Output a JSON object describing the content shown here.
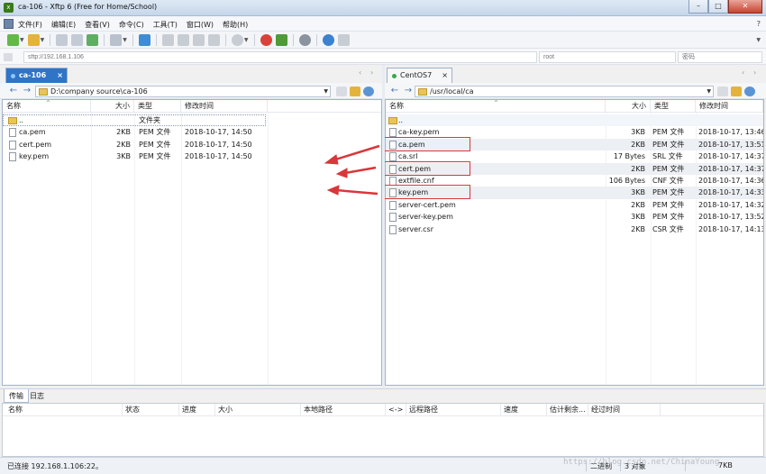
{
  "window": {
    "title": "ca-106 - Xftp 6 (Free for Home/School)",
    "app_icon": "xftp-app-icon",
    "accent_color": "#2f74c7",
    "controls": {
      "minimize": "–",
      "maximize": "□",
      "close": "✕"
    }
  },
  "menubar": {
    "items": [
      "文件(F)",
      "编辑(E)",
      "查看(V)",
      "命令(C)",
      "工具(T)",
      "窗口(W)",
      "帮助(H)"
    ],
    "help_glyph": "?"
  },
  "addressbar": {
    "host_placeholder": "sftp://192.168.1.106",
    "user_placeholder": "root",
    "password_placeholder": "密码"
  },
  "left_panel": {
    "tab_label": "ca-106",
    "path": "D:\\company source\\ca-106",
    "columns": [
      "名称",
      "大小",
      "类型",
      "修改时间"
    ],
    "files": [
      {
        "name": "..",
        "size": "",
        "type": "文件夹",
        "modified": "",
        "folder": true
      },
      {
        "name": "ca.pem",
        "size": "2KB",
        "type": "PEM 文件",
        "modified": "2018-10-17, 14:50"
      },
      {
        "name": "cert.pem",
        "size": "2KB",
        "type": "PEM 文件",
        "modified": "2018-10-17, 14:50"
      },
      {
        "name": "key.pem",
        "size": "3KB",
        "type": "PEM 文件",
        "modified": "2018-10-17, 14:50"
      }
    ]
  },
  "right_panel": {
    "tab_label": "CentOS7",
    "path": "/usr/local/ca",
    "columns": [
      "名称",
      "大小",
      "类型",
      "修改时间"
    ],
    "files": [
      {
        "name": "..",
        "size": "",
        "type": "",
        "modified": "",
        "folder": true
      },
      {
        "name": "ca-key.pem",
        "size": "3KB",
        "type": "PEM 文件",
        "modified": "2018-10-17, 13:46"
      },
      {
        "name": "ca.pem",
        "size": "2KB",
        "type": "PEM 文件",
        "modified": "2018-10-17, 13:51"
      },
      {
        "name": "ca.srl",
        "size": "17 Bytes",
        "type": "SRL 文件",
        "modified": "2018-10-17, 14:37"
      },
      {
        "name": "cert.pem",
        "size": "2KB",
        "type": "PEM 文件",
        "modified": "2018-10-17, 14:37"
      },
      {
        "name": "extfile.cnf",
        "size": "106 Bytes",
        "type": "CNF 文件",
        "modified": "2018-10-17, 14:36"
      },
      {
        "name": "key.pem",
        "size": "3KB",
        "type": "PEM 文件",
        "modified": "2018-10-17, 14:33"
      },
      {
        "name": "server-cert.pem",
        "size": "2KB",
        "type": "PEM 文件",
        "modified": "2018-10-17, 14:32"
      },
      {
        "name": "server-key.pem",
        "size": "3KB",
        "type": "PEM 文件",
        "modified": "2018-10-17, 13:52"
      },
      {
        "name": "server.csr",
        "size": "2KB",
        "type": "CSR 文件",
        "modified": "2018-10-17, 14:13"
      }
    ],
    "highlighted": [
      "ca.pem",
      "cert.pem",
      "key.pem"
    ],
    "highlight_color": "#d9373a"
  },
  "bottom": {
    "tabs": [
      "传输",
      "日志"
    ],
    "columns": [
      "名称",
      "状态",
      "进度",
      "大小",
      "本地路径",
      "<->",
      "远程路径",
      "速度",
      "估计剩余...",
      "经过时间"
    ]
  },
  "statusbar": {
    "connection": "已连接 192.168.1.106:22。",
    "mode": "二进制",
    "objects": "3 对象",
    "size": "7KB",
    "watermark": "https://blog.csdn.net/ChinaYoung"
  }
}
